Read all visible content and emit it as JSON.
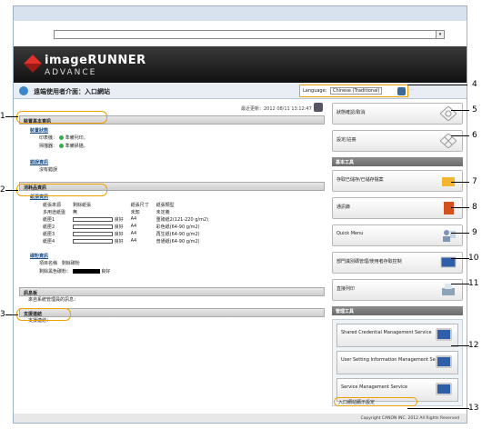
{
  "window": {
    "dropdown_arrow": "▾"
  },
  "brand": {
    "line1": "imageRUNNER",
    "line2": "ADVANCE"
  },
  "header": {
    "title": "遠端使用者介面：入口網站",
    "language_label": "Language:",
    "language_value": "Chinese (Traditional)",
    "hint": "..."
  },
  "updated": "最近更新：2012 08/11 13:12:47",
  "device": {
    "section": "裝置基本資訊",
    "status_title": "裝置狀態",
    "printer_label": "印表機：",
    "printer_status": "準備列印。",
    "scanner_label": "掃描器：",
    "scanner_status": "準備掃描。",
    "error_title": "錯誤資訊",
    "error_value": "沒有錯誤"
  },
  "consumables": {
    "section": "消耗品資訊",
    "paper_title": "紙張資訊",
    "headers": [
      "紙張來源",
      "剩餘紙張",
      "紙張尺寸",
      "紙張類型"
    ],
    "rows": [
      {
        "source": "多用途紙盤",
        "remaining": "無",
        "size": "未知",
        "type": "未定義",
        "bar": false
      },
      {
        "source": "紙匣1",
        "remaining": "良好",
        "size": "A4",
        "type": "重磅紙2(121-220 g/m2)",
        "bar": true
      },
      {
        "source": "紙匣2",
        "remaining": "良好",
        "size": "A4",
        "type": "彩色紙(64-90 g/m2)",
        "bar": true
      },
      {
        "source": "紙匣3",
        "remaining": "良好",
        "size": "A4",
        "type": "再生紙(64-90 g/m2)",
        "bar": true
      },
      {
        "source": "紙匣4",
        "remaining": "良好",
        "size": "A4",
        "type": "普通紙(64-90 g/m2)",
        "bar": true
      }
    ],
    "toner_title": "碳粉資訊",
    "toner_headers": [
      "項目名稱",
      "剩餘碳粉"
    ],
    "toner_item": "剩餘黑色碳粉：",
    "toner_status": "良好"
  },
  "bulletin": {
    "section": "訊息板",
    "text": "來自系統管理員的訊息："
  },
  "support": {
    "section": "支援連結",
    "text": "支援連結："
  },
  "side": {
    "auth": "狀態確認/取消",
    "settings": "設定/註冊",
    "basic_head": "基本工具",
    "basic": [
      "存取已儲存/已儲存檔案",
      "通訊錄",
      "Quick Menu",
      "部門識別碼管理/使用者存取控制",
      "直接列印"
    ],
    "mgmt_head": "管理工具",
    "mgmt": [
      "Shared Credential Management Service",
      "User Setting Information Management Service",
      "Service Management Service"
    ]
  },
  "portal_link": "入口網站顯示設定",
  "copyright": "Copyright CANON INC. 2012 All Rights Reserved",
  "callouts": [
    "1",
    "2",
    "3",
    "4",
    "5",
    "6",
    "7",
    "8",
    "9",
    "10",
    "11",
    "12",
    "13"
  ]
}
